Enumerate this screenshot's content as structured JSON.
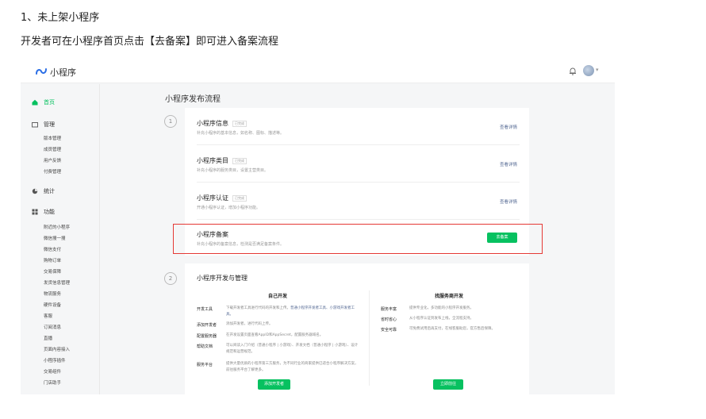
{
  "doc": {
    "heading": "1、未上架小程序",
    "text": "开发者可在小程序首页点击【去备案】即可进入备案流程"
  },
  "app": {
    "logo_text": "小程序",
    "brand_color": "#07c160",
    "avatar_caret": "▾"
  },
  "sidebar": {
    "home": "首页",
    "manage": "管理",
    "manage_items": [
      "版本管理",
      "成员管理",
      "用户反馈",
      "付费管理"
    ],
    "stats": "统计",
    "features": "功能",
    "feature_items": [
      "附近的小程序",
      "微信搜一搜",
      "微信支付",
      "购物订单",
      "交易保障",
      "发货信息管理",
      "物流服务",
      "硬件设备",
      "客服",
      "订阅消息",
      "直播",
      "页面内容接入",
      "小程序插件",
      "交易组件",
      "门店助手"
    ]
  },
  "main": {
    "title": "小程序发布流程",
    "step1": "1",
    "step2": "2",
    "rows": [
      {
        "title": "小程序信息",
        "tag": "已完成",
        "desc": "补充小程序的基本信息，如名称、图标、描述等。",
        "link": "查看详情"
      },
      {
        "title": "小程序类目",
        "tag": "已完成",
        "desc": "补充小程序的服务类目，设置主营类目。",
        "link": "查看详情"
      },
      {
        "title": "小程序认证",
        "tag": "已完成",
        "desc": "开通小程序认证，增加小程序功能。",
        "link": "查看详情"
      },
      {
        "title": "小程序备案",
        "desc": "补充小程序的备案信息，检测是否满足备案条件。",
        "button": "去备案"
      }
    ],
    "section2": {
      "title": "小程序开发与管理",
      "left": {
        "title": "自己开发",
        "features": [
          {
            "label": "开发工具",
            "desc": "下载开发者工具进行代码的开发和上传。",
            "link": "普通小程序开发者工具、小游戏开发者工具。"
          },
          {
            "label": "添加开发者",
            "desc": "添加开发者，进行代码上传。",
            "link": ""
          },
          {
            "label": "配置服务器",
            "desc": "在开发设置页面查看AppID和AppSecret，配置服务器域名。",
            "link": ""
          },
          {
            "label": "帮助文档",
            "desc": "可以阅读入门介绍（普通小程序 | 小游戏）、开发文档（普通小程序 | 小游戏）、设计规范和运营规范。",
            "link": ""
          },
          {
            "label": "服务平台",
            "desc": "提供大量优质的小程序第三方服务，为不同行业的商家提供已适合小程序解决方案，前往服务平台了解更多。",
            "link": ""
          }
        ],
        "button": "添加开发者"
      },
      "right": {
        "title": "找服务商开发",
        "features": [
          {
            "label": "服务丰富",
            "desc": "提供专业化，多功能的小程序开发服务。"
          },
          {
            "label": "省时省心",
            "desc": "从小程序认证到发布上线，全流程支持。"
          },
          {
            "label": "安全可靠",
            "desc": "可免费试用后再支付，在线客服助您，官方售后保障。"
          }
        ],
        "button": "立即前往"
      }
    }
  }
}
